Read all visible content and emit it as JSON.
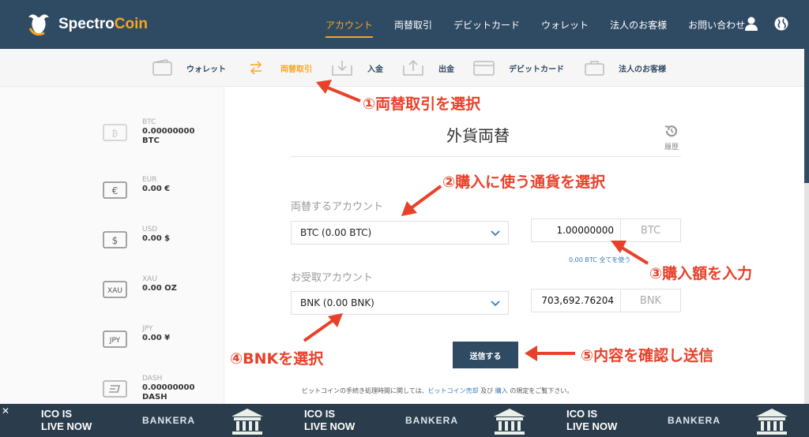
{
  "brand": {
    "name_part1": "Spectro",
    "name_part2": "Coin"
  },
  "top_nav": [
    "アカウント",
    "両替取引",
    "デビットカード",
    "ウォレット",
    "法人のお客様",
    "お問い合わせ"
  ],
  "top_nav_active": "アカウント",
  "sub_nav": {
    "wallet": "ウォレット",
    "exchange": "両替取引",
    "deposit": "入金",
    "withdraw": "出金",
    "debit": "デビットカード",
    "business": "法人のお客様"
  },
  "wallets": [
    {
      "code": "BTC",
      "balance": "0.00000000",
      "unit": "BTC",
      "icon": "bitcoin-wallet-icon"
    },
    {
      "code": "EUR",
      "balance": "0.00 €",
      "icon": "euro-wallet-icon"
    },
    {
      "code": "USD",
      "balance": "0.00 $",
      "icon": "dollar-wallet-icon"
    },
    {
      "code": "XAU",
      "balance": "0.00 OZ",
      "icon": "gold-wallet-icon",
      "badge": "XAU"
    },
    {
      "code": "JPY",
      "balance": "0.00 ¥",
      "icon": "yen-wallet-icon",
      "badge": "JPY"
    },
    {
      "code": "DASH",
      "balance": "0.00000000",
      "unit": "DASH",
      "icon": "dash-wallet-icon"
    }
  ],
  "main": {
    "title": "外貨両替",
    "history_label": "履歴",
    "from_label": "両替するアカウント",
    "from_account": "BTC (0.00 BTC)",
    "from_amount": "1.00000000",
    "from_currency": "BTC",
    "use_all": "0.00 BTC 全てを使う",
    "to_label": "お受取アカウント",
    "to_account": "BNK (0.00 BNK)",
    "to_amount": "703,692.76204",
    "to_currency": "BNK",
    "submit": "送信する",
    "notice_prefix": "ビットコインの手続き処理時間に関しては、",
    "notice_link1": "ビットコイン売却",
    "notice_mid": " 及び ",
    "notice_link2": "購入",
    "notice_suffix": " の規定をご覧下さい。"
  },
  "annotations": {
    "step1": "①両替取引を選択",
    "step2": "②購入に使う通貨を選択",
    "step3": "③購入額を入力",
    "step4": "④BNKを選択",
    "step5": "⑤内容を確認し送信"
  },
  "ad": {
    "line1": "ICO IS",
    "line2": "LIVE NOW",
    "brand": "BANKERA",
    "close": "✕"
  },
  "colors": {
    "navy": "#2f4a63",
    "accent": "#f5a623",
    "annotation": "#e8412a",
    "link": "#3a7ab8"
  }
}
